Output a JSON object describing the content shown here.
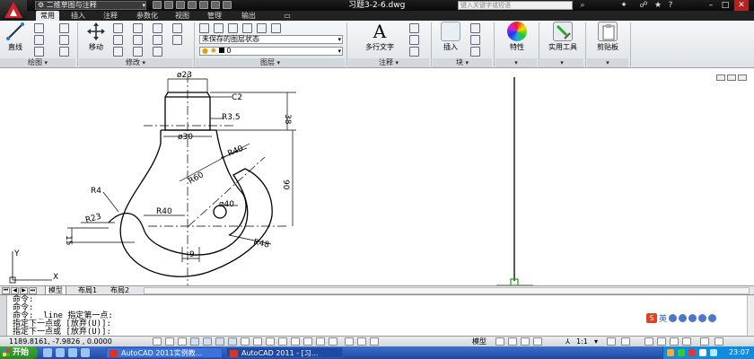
{
  "window": {
    "workspace": "二维草图与注释",
    "title": "习题3-2-6.dwg",
    "help_search_placeholder": "键入关键字或短语"
  },
  "ribbon_tabs": [
    "常用",
    "插入",
    "注释",
    "参数化",
    "视图",
    "管理",
    "输出"
  ],
  "ribbon": {
    "draw": {
      "line_label": "直线",
      "panel_title": "绘图"
    },
    "modify": {
      "move_label": "移动",
      "panel_title": "修改"
    },
    "layers": {
      "layer_state": "未保存的图层状态",
      "current_layer": "0",
      "panel_title": "图层"
    },
    "annotation": {
      "mtext_label": "多行文字",
      "panel_title": "注释"
    },
    "block": {
      "insert_label": "插入",
      "panel_title": "块"
    },
    "properties_label": "特性",
    "utilities_label": "实用工具",
    "clipboard_label": "剪贴板"
  },
  "drawing_dims": {
    "d23": "ø23",
    "c2": "C2",
    "r35": "R3.5",
    "len38": "38",
    "d30": "ø30",
    "r40_top": "R40",
    "r60": "R60",
    "len90": "90",
    "d40": "ø40",
    "r4": "R4",
    "r23": "R23",
    "r40_mid": "R40",
    "r48": "R48",
    "len15": "15",
    "len9": "9"
  },
  "ucs": {
    "x": "X",
    "y": "Y"
  },
  "layout_tabs": [
    "模型",
    "布局1",
    "布局2"
  ],
  "command_lines": [
    "命令:",
    "命令:",
    "命令: _line 指定第一点:",
    "指定下一点或 [放弃(U)]:",
    "指定下一点或 [放弃(U)]:"
  ],
  "ime": {
    "lang": "英"
  },
  "status": {
    "coords": "1189.8161, -7.9826 , 0.0000",
    "model": "模型",
    "scale": "1:1"
  },
  "taskbar": {
    "start": "开始",
    "tasks": [
      "AutoCAD 2011实例教...",
      "AutoCAD 2011 - [习..."
    ],
    "clock": "23:07"
  },
  "colors": {
    "accent": "#d0232a",
    "ribbon_bg": "#e4e7eb",
    "taskbar": "#2a5cc2"
  }
}
